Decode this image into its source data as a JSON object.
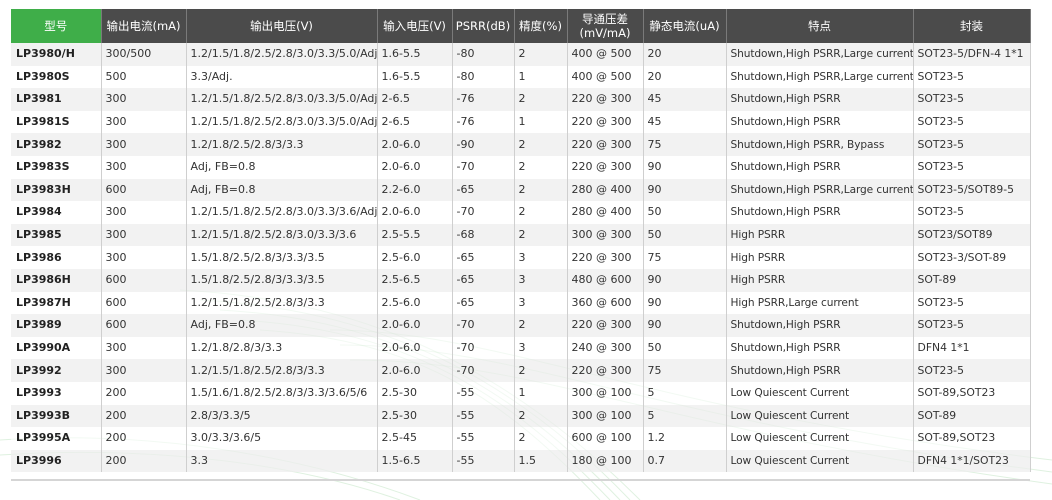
{
  "table": {
    "headers": [
      "型号",
      "输出电流(mA)",
      "输出电压(V)",
      "输入电压(V)",
      "PSRR(dB)",
      "精度(%)",
      "导通压差\n(mV/mA)",
      "静态电流(uA)",
      "特点",
      "封装"
    ],
    "rows": [
      [
        "LP3980/H",
        "300/500",
        "1.2/1.5/1.8/2.5/2.8/3.0/3.3/5.0/Adj.",
        "1.6-5.5",
        "-80",
        "2",
        "400 @ 500",
        "20",
        "Shutdown,High PSRR,Large current",
        "SOT23-5/DFN-4 1*1"
      ],
      [
        "LP3980S",
        "500",
        "3.3/Adj.",
        "1.6-5.5",
        "-80",
        "1",
        "400 @ 500",
        "20",
        "Shutdown,High PSRR,Large current",
        "SOT23-5"
      ],
      [
        "LP3981",
        "300",
        "1.2/1.5/1.8/2.5/2.8/3.0/3.3/5.0/Adj.",
        "2-6.5",
        "-76",
        "2",
        "220 @ 300",
        "45",
        "Shutdown,High PSRR",
        "SOT23-5"
      ],
      [
        "LP3981S",
        "300",
        "1.2/1.5/1.8/2.5/2.8/3.0/3.3/5.0/Adj.",
        "2-6.5",
        "-76",
        "1",
        "220 @ 300",
        "45",
        "Shutdown,High PSRR",
        "SOT23-5"
      ],
      [
        "LP3982",
        "300",
        "1.2/1.8/2.5/2.8/3/3.3",
        "2.0-6.0",
        "-90",
        "2",
        "220 @ 300",
        "75",
        "Shutdown,High PSRR, Bypass",
        "SOT23-5"
      ],
      [
        "LP3983S",
        "300",
        "Adj, FB=0.8",
        "2.0-6.0",
        "-70",
        "2",
        "220 @ 300",
        "90",
        "Shutdown,High PSRR",
        "SOT23-5"
      ],
      [
        "LP3983H",
        "600",
        "Adj, FB=0.8",
        "2.2-6.0",
        "-65",
        "2",
        "280 @ 400",
        "90",
        "Shutdown,High PSRR,Large current",
        "SOT23-5/SOT89-5"
      ],
      [
        "LP3984",
        "300",
        "1.2/1.5/1.8/2.5/2.8/3.0/3.3/3.6/Adj.",
        "2.0-6.0",
        "-70",
        "2",
        "280 @ 400",
        "50",
        "Shutdown,High PSRR",
        "SOT23-5"
      ],
      [
        "LP3985",
        "300",
        "1.2/1.5/1.8/2.5/2.8/3.0/3.3/3.6",
        "2.5-5.5",
        "-68",
        "2",
        "300 @ 300",
        "50",
        "High PSRR",
        "SOT23/SOT89"
      ],
      [
        "LP3986",
        "300",
        "1.5/1.8/2.5/2.8/3/3.3/3.5",
        "2.5-6.0",
        "-65",
        "3",
        "220 @ 300",
        "75",
        "High PSRR",
        "SOT23-3/SOT-89"
      ],
      [
        "LP3986H",
        "600",
        "1.5/1.8/2.5/2.8/3/3.3/3.5",
        "2.5-6.5",
        "-65",
        "3",
        "480 @ 600",
        "90",
        "High PSRR",
        "SOT-89"
      ],
      [
        "LP3987H",
        "600",
        "1.2/1.5/1.8/2.5/2.8/3/3.3",
        "2.5-6.0",
        "-65",
        "3",
        "360 @ 600",
        "90",
        "High PSRR,Large current",
        "SOT23-5"
      ],
      [
        "LP3989",
        "600",
        "Adj, FB=0.8",
        "2.0-6.0",
        "-70",
        "2",
        "220 @ 300",
        "90",
        "Shutdown,High PSRR",
        "SOT23-5"
      ],
      [
        "LP3990A",
        "300",
        "1.2/1.8/2.8/3/3.3",
        "2.0-6.0",
        "-70",
        "3",
        "240 @ 300",
        "50",
        "Shutdown,High PSRR",
        "DFN4 1*1"
      ],
      [
        "LP3992",
        "300",
        "1.2/1.5/1.8/2.5/2.8/3/3.3",
        "2.0-6.0",
        "-70",
        "2",
        "220 @ 300",
        "75",
        "Shutdown,High PSRR",
        "SOT23-5"
      ],
      [
        "LP3993",
        "200",
        "1.5/1.6/1.8/2.5/2.8/3/3.3/3.6/5/6",
        "2.5-30",
        "-55",
        "1",
        "300 @ 100",
        "5",
        "Low Quiescent Current",
        "SOT-89,SOT23"
      ],
      [
        "LP3993B",
        "200",
        "2.8/3/3.3/5",
        "2.5-30",
        "-55",
        "2",
        "300 @ 100",
        "5",
        "Low Quiescent Current",
        "SOT-89"
      ],
      [
        "LP3995A",
        "200",
        "3.0/3.3/3.6/5",
        "2.5-45",
        "-55",
        "2",
        "600 @ 100",
        "1.2",
        "Low Quiescent Current",
        "SOT-89,SOT23"
      ],
      [
        "LP3996",
        "200",
        "3.3",
        "1.5-6.5",
        "-55",
        "1.5",
        "180 @ 100",
        "0.7",
        "Low Quiescent Current",
        "DFN4 1*1/SOT23"
      ]
    ]
  },
  "colors": {
    "header_bg": "#4b4b4b",
    "header_first_bg": "#3fae49",
    "row_stripe": "#eeeeee",
    "swoosh": "#6cc070"
  }
}
